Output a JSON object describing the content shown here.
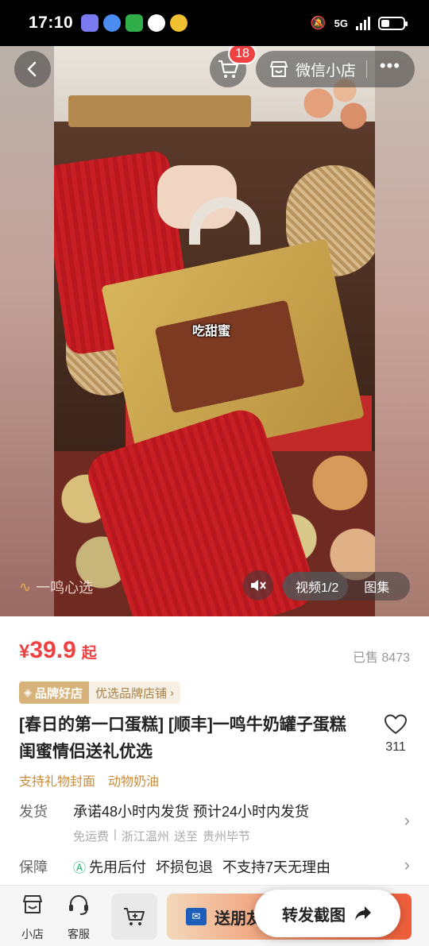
{
  "status_bar": {
    "time": "17:10",
    "network": "5G"
  },
  "media": {
    "cart_badge": "18",
    "shop_label": "微信小店",
    "more_label": "•••",
    "caption": "吃甜蜜",
    "watermark": "一鸣心选",
    "video_index": "视频1/2",
    "gallery_label": "图集"
  },
  "product": {
    "currency": "¥",
    "price": "39.9",
    "price_suffix": "起",
    "sold_label": "已售",
    "sold_count": "8473",
    "brand_badge": "品牌好店",
    "brand_link": "优选品牌店铺",
    "title": "[春日的第一口蛋糕] [顺丰]一鸣牛奶罐子蛋糕 闺蜜情侣送礼优选",
    "fav_count": "311",
    "tags": [
      "支持礼物封面",
      "动物奶油"
    ]
  },
  "shipping": {
    "label": "发货",
    "main": "承诺48小时内发货  预计24小时内发货",
    "free": "免运费",
    "from": "浙江温州",
    "to_word": "送至",
    "to": "贵州毕节"
  },
  "guarantee": {
    "label": "保障",
    "items": [
      "先用后付",
      "坏损包退",
      "不支持7天无理由"
    ]
  },
  "bottom_bar": {
    "shop_label": "小店",
    "service_label": "客服",
    "gift_label": "送朋友",
    "share_label": "转发截图"
  },
  "colors": {
    "accent": "#f04142",
    "brand_gold": "#d7b27b",
    "tag_text": "#c98c3c"
  },
  "icons": {
    "back": "back-arrow-icon",
    "cart": "cart-icon",
    "shop": "store-icon",
    "mute": "mute-icon",
    "favorite": "heart-icon",
    "service": "headset-icon",
    "share": "share-arrow-icon"
  }
}
